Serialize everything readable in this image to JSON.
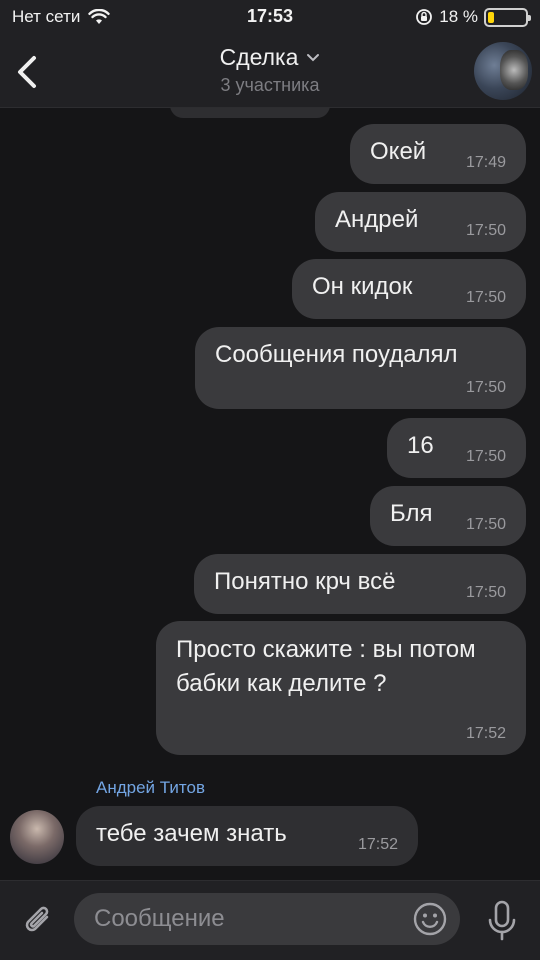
{
  "status_bar": {
    "carrier": "Нет сети",
    "time": "17:53",
    "battery_percent": "18 %",
    "battery_level": 0.18
  },
  "header": {
    "title": "Сделка",
    "subtitle": "3 участника"
  },
  "messages": [
    {
      "text": "Окей",
      "time": "17:49"
    },
    {
      "text": "Андрей",
      "time": "17:50"
    },
    {
      "text": "Он кидок",
      "time": "17:50"
    },
    {
      "text": "Сообщения поудалял",
      "time": "17:50"
    },
    {
      "text": "16",
      "time": "17:50"
    },
    {
      "text": "Бля",
      "time": "17:50"
    },
    {
      "text": "Понятно крч всё",
      "time": "17:50"
    },
    {
      "text": "Просто скажите : вы потом бабки как делите ?",
      "time": "17:52"
    }
  ],
  "incoming": {
    "sender": "Андрей Титов",
    "text": "тебе зачем знать",
    "time": "17:52"
  },
  "composer": {
    "placeholder": "Сообщение"
  },
  "colors": {
    "accent": "#73a5e3",
    "battery": "#ffd60a"
  }
}
